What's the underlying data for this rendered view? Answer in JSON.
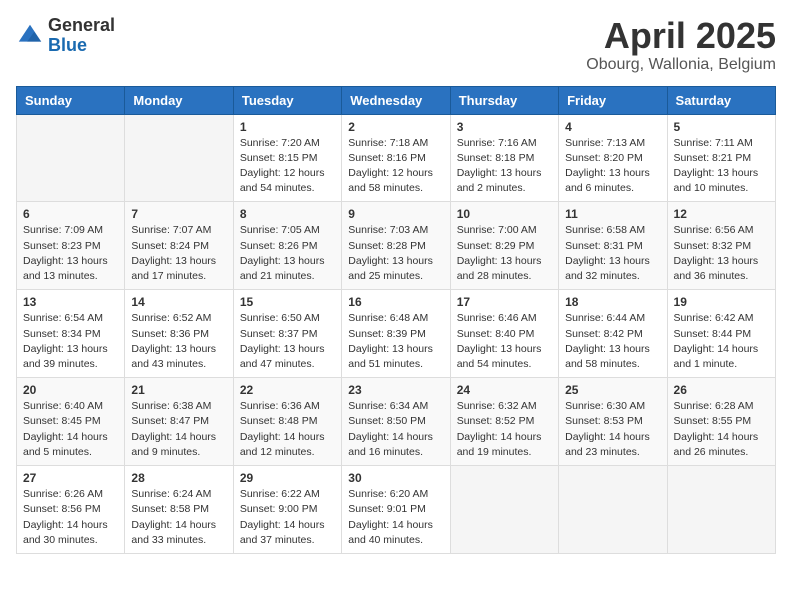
{
  "logo": {
    "general": "General",
    "blue": "Blue"
  },
  "title": "April 2025",
  "subtitle": "Obourg, Wallonia, Belgium",
  "header": {
    "days": [
      "Sunday",
      "Monday",
      "Tuesday",
      "Wednesday",
      "Thursday",
      "Friday",
      "Saturday"
    ]
  },
  "weeks": [
    [
      {
        "day": "",
        "sunrise": "",
        "sunset": "",
        "daylight": ""
      },
      {
        "day": "",
        "sunrise": "",
        "sunset": "",
        "daylight": ""
      },
      {
        "day": "1",
        "sunrise": "Sunrise: 7:20 AM",
        "sunset": "Sunset: 8:15 PM",
        "daylight": "Daylight: 12 hours and 54 minutes."
      },
      {
        "day": "2",
        "sunrise": "Sunrise: 7:18 AM",
        "sunset": "Sunset: 8:16 PM",
        "daylight": "Daylight: 12 hours and 58 minutes."
      },
      {
        "day": "3",
        "sunrise": "Sunrise: 7:16 AM",
        "sunset": "Sunset: 8:18 PM",
        "daylight": "Daylight: 13 hours and 2 minutes."
      },
      {
        "day": "4",
        "sunrise": "Sunrise: 7:13 AM",
        "sunset": "Sunset: 8:20 PM",
        "daylight": "Daylight: 13 hours and 6 minutes."
      },
      {
        "day": "5",
        "sunrise": "Sunrise: 7:11 AM",
        "sunset": "Sunset: 8:21 PM",
        "daylight": "Daylight: 13 hours and 10 minutes."
      }
    ],
    [
      {
        "day": "6",
        "sunrise": "Sunrise: 7:09 AM",
        "sunset": "Sunset: 8:23 PM",
        "daylight": "Daylight: 13 hours and 13 minutes."
      },
      {
        "day": "7",
        "sunrise": "Sunrise: 7:07 AM",
        "sunset": "Sunset: 8:24 PM",
        "daylight": "Daylight: 13 hours and 17 minutes."
      },
      {
        "day": "8",
        "sunrise": "Sunrise: 7:05 AM",
        "sunset": "Sunset: 8:26 PM",
        "daylight": "Daylight: 13 hours and 21 minutes."
      },
      {
        "day": "9",
        "sunrise": "Sunrise: 7:03 AM",
        "sunset": "Sunset: 8:28 PM",
        "daylight": "Daylight: 13 hours and 25 minutes."
      },
      {
        "day": "10",
        "sunrise": "Sunrise: 7:00 AM",
        "sunset": "Sunset: 8:29 PM",
        "daylight": "Daylight: 13 hours and 28 minutes."
      },
      {
        "day": "11",
        "sunrise": "Sunrise: 6:58 AM",
        "sunset": "Sunset: 8:31 PM",
        "daylight": "Daylight: 13 hours and 32 minutes."
      },
      {
        "day": "12",
        "sunrise": "Sunrise: 6:56 AM",
        "sunset": "Sunset: 8:32 PM",
        "daylight": "Daylight: 13 hours and 36 minutes."
      }
    ],
    [
      {
        "day": "13",
        "sunrise": "Sunrise: 6:54 AM",
        "sunset": "Sunset: 8:34 PM",
        "daylight": "Daylight: 13 hours and 39 minutes."
      },
      {
        "day": "14",
        "sunrise": "Sunrise: 6:52 AM",
        "sunset": "Sunset: 8:36 PM",
        "daylight": "Daylight: 13 hours and 43 minutes."
      },
      {
        "day": "15",
        "sunrise": "Sunrise: 6:50 AM",
        "sunset": "Sunset: 8:37 PM",
        "daylight": "Daylight: 13 hours and 47 minutes."
      },
      {
        "day": "16",
        "sunrise": "Sunrise: 6:48 AM",
        "sunset": "Sunset: 8:39 PM",
        "daylight": "Daylight: 13 hours and 51 minutes."
      },
      {
        "day": "17",
        "sunrise": "Sunrise: 6:46 AM",
        "sunset": "Sunset: 8:40 PM",
        "daylight": "Daylight: 13 hours and 54 minutes."
      },
      {
        "day": "18",
        "sunrise": "Sunrise: 6:44 AM",
        "sunset": "Sunset: 8:42 PM",
        "daylight": "Daylight: 13 hours and 58 minutes."
      },
      {
        "day": "19",
        "sunrise": "Sunrise: 6:42 AM",
        "sunset": "Sunset: 8:44 PM",
        "daylight": "Daylight: 14 hours and 1 minute."
      }
    ],
    [
      {
        "day": "20",
        "sunrise": "Sunrise: 6:40 AM",
        "sunset": "Sunset: 8:45 PM",
        "daylight": "Daylight: 14 hours and 5 minutes."
      },
      {
        "day": "21",
        "sunrise": "Sunrise: 6:38 AM",
        "sunset": "Sunset: 8:47 PM",
        "daylight": "Daylight: 14 hours and 9 minutes."
      },
      {
        "day": "22",
        "sunrise": "Sunrise: 6:36 AM",
        "sunset": "Sunset: 8:48 PM",
        "daylight": "Daylight: 14 hours and 12 minutes."
      },
      {
        "day": "23",
        "sunrise": "Sunrise: 6:34 AM",
        "sunset": "Sunset: 8:50 PM",
        "daylight": "Daylight: 14 hours and 16 minutes."
      },
      {
        "day": "24",
        "sunrise": "Sunrise: 6:32 AM",
        "sunset": "Sunset: 8:52 PM",
        "daylight": "Daylight: 14 hours and 19 minutes."
      },
      {
        "day": "25",
        "sunrise": "Sunrise: 6:30 AM",
        "sunset": "Sunset: 8:53 PM",
        "daylight": "Daylight: 14 hours and 23 minutes."
      },
      {
        "day": "26",
        "sunrise": "Sunrise: 6:28 AM",
        "sunset": "Sunset: 8:55 PM",
        "daylight": "Daylight: 14 hours and 26 minutes."
      }
    ],
    [
      {
        "day": "27",
        "sunrise": "Sunrise: 6:26 AM",
        "sunset": "Sunset: 8:56 PM",
        "daylight": "Daylight: 14 hours and 30 minutes."
      },
      {
        "day": "28",
        "sunrise": "Sunrise: 6:24 AM",
        "sunset": "Sunset: 8:58 PM",
        "daylight": "Daylight: 14 hours and 33 minutes."
      },
      {
        "day": "29",
        "sunrise": "Sunrise: 6:22 AM",
        "sunset": "Sunset: 9:00 PM",
        "daylight": "Daylight: 14 hours and 37 minutes."
      },
      {
        "day": "30",
        "sunrise": "Sunrise: 6:20 AM",
        "sunset": "Sunset: 9:01 PM",
        "daylight": "Daylight: 14 hours and 40 minutes."
      },
      {
        "day": "",
        "sunrise": "",
        "sunset": "",
        "daylight": ""
      },
      {
        "day": "",
        "sunrise": "",
        "sunset": "",
        "daylight": ""
      },
      {
        "day": "",
        "sunrise": "",
        "sunset": "",
        "daylight": ""
      }
    ]
  ]
}
